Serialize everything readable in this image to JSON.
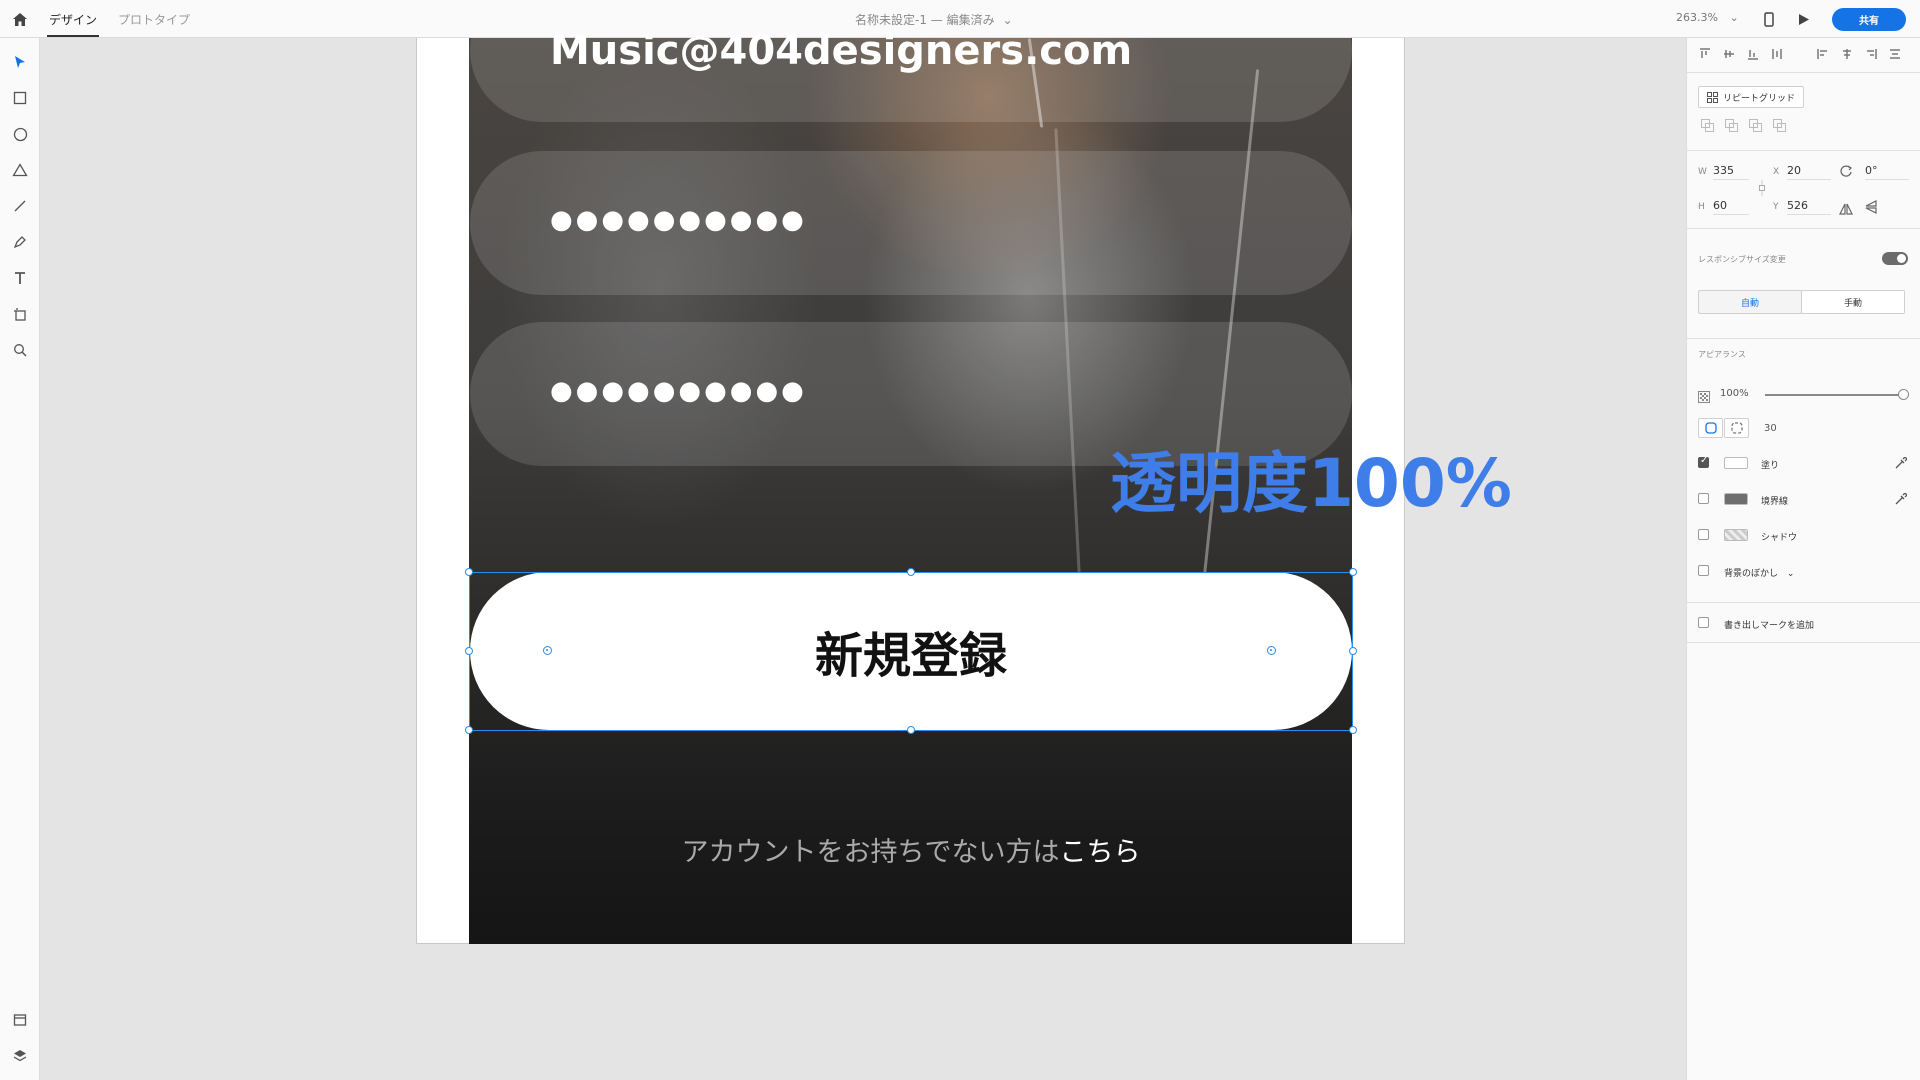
{
  "topbar": {
    "tabs": [
      {
        "label": "デザイン"
      },
      {
        "label": "プロトタイプ"
      }
    ],
    "document_title": "名称未設定-1 — 編集済み",
    "zoom": "263.3%",
    "share_label": "共有"
  },
  "canvas": {
    "email_value": "Music@404designers.com",
    "password_mask_1": "●●●●●●●●●●",
    "password_mask_2": "●●●●●●●●●●",
    "signup_label": "新規登録",
    "account_prefix": "アカウントをお持ちでない方は",
    "account_link": "こちら",
    "overlay_label": "透明度100%"
  },
  "properties": {
    "repeat_grid_label": "リピートグリッド",
    "w_label": "W",
    "w_value": "335",
    "h_label": "H",
    "h_value": "60",
    "x_label": "X",
    "x_value": "20",
    "y_label": "Y",
    "y_value": "526",
    "rotation": "0°",
    "responsive_label": "レスポンシブサイズ変更",
    "auto_label": "自動",
    "manual_label": "手動",
    "appearance_label": "アピアランス",
    "opacity_value": "100%",
    "opacity_fraction": 1.0,
    "corner_radius": "30",
    "fill_label": "塗り",
    "border_label": "境界線",
    "shadow_label": "シャドウ",
    "bg_blur_label": "背景のぼかし",
    "export_mark_label": "書き出しマークを追加"
  },
  "colors": {
    "accent": "#1473e6",
    "selection": "#2d8ceb",
    "overlay_text": "#3f7ee8",
    "fill_swatch": "#ffffff",
    "border_swatch": "#6e6e6e"
  }
}
